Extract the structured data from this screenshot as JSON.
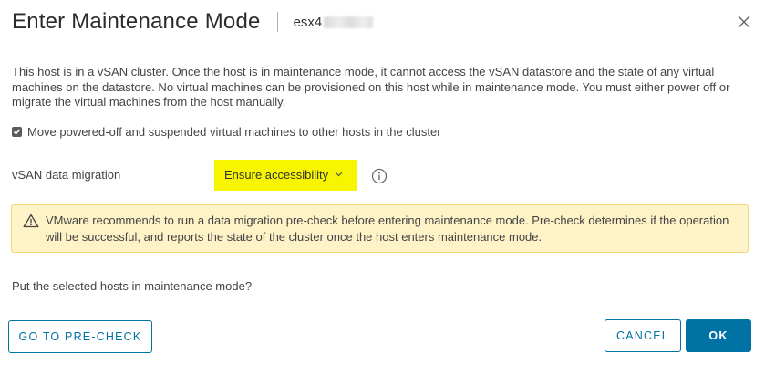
{
  "dialog": {
    "title": "Enter Maintenance Mode",
    "host_name": "esx4"
  },
  "description": "This host is in a vSAN cluster. Once the host is in maintenance mode, it cannot access the vSAN datastore and the state of any virtual machines on the datastore. No virtual machines can be provisioned on this host while in maintenance mode. You must either power off or migrate the virtual machines from the host manually.",
  "move_vms": {
    "label": "Move powered-off and suspended virtual machines to other hosts in the cluster",
    "checked": true
  },
  "vsan_migration": {
    "label": "vSAN data migration",
    "selected": "Ensure accessibility",
    "highlight_color": "#f7f600"
  },
  "alert": {
    "text": "VMware recommends to run a data migration pre-check before entering maintenance mode. Pre-check determines if the operation will be successful, and reports the state of the cluster once the host enters maintenance mode.",
    "icon": "warning-icon"
  },
  "question": "Put the selected hosts in maintenance mode?",
  "buttons": {
    "precheck": "GO TO PRE-CHECK",
    "cancel": "CANCEL",
    "ok": "OK"
  },
  "colors": {
    "primary": "#0072a3",
    "alert_bg": "#fef3c7",
    "alert_border": "#f5d473"
  }
}
